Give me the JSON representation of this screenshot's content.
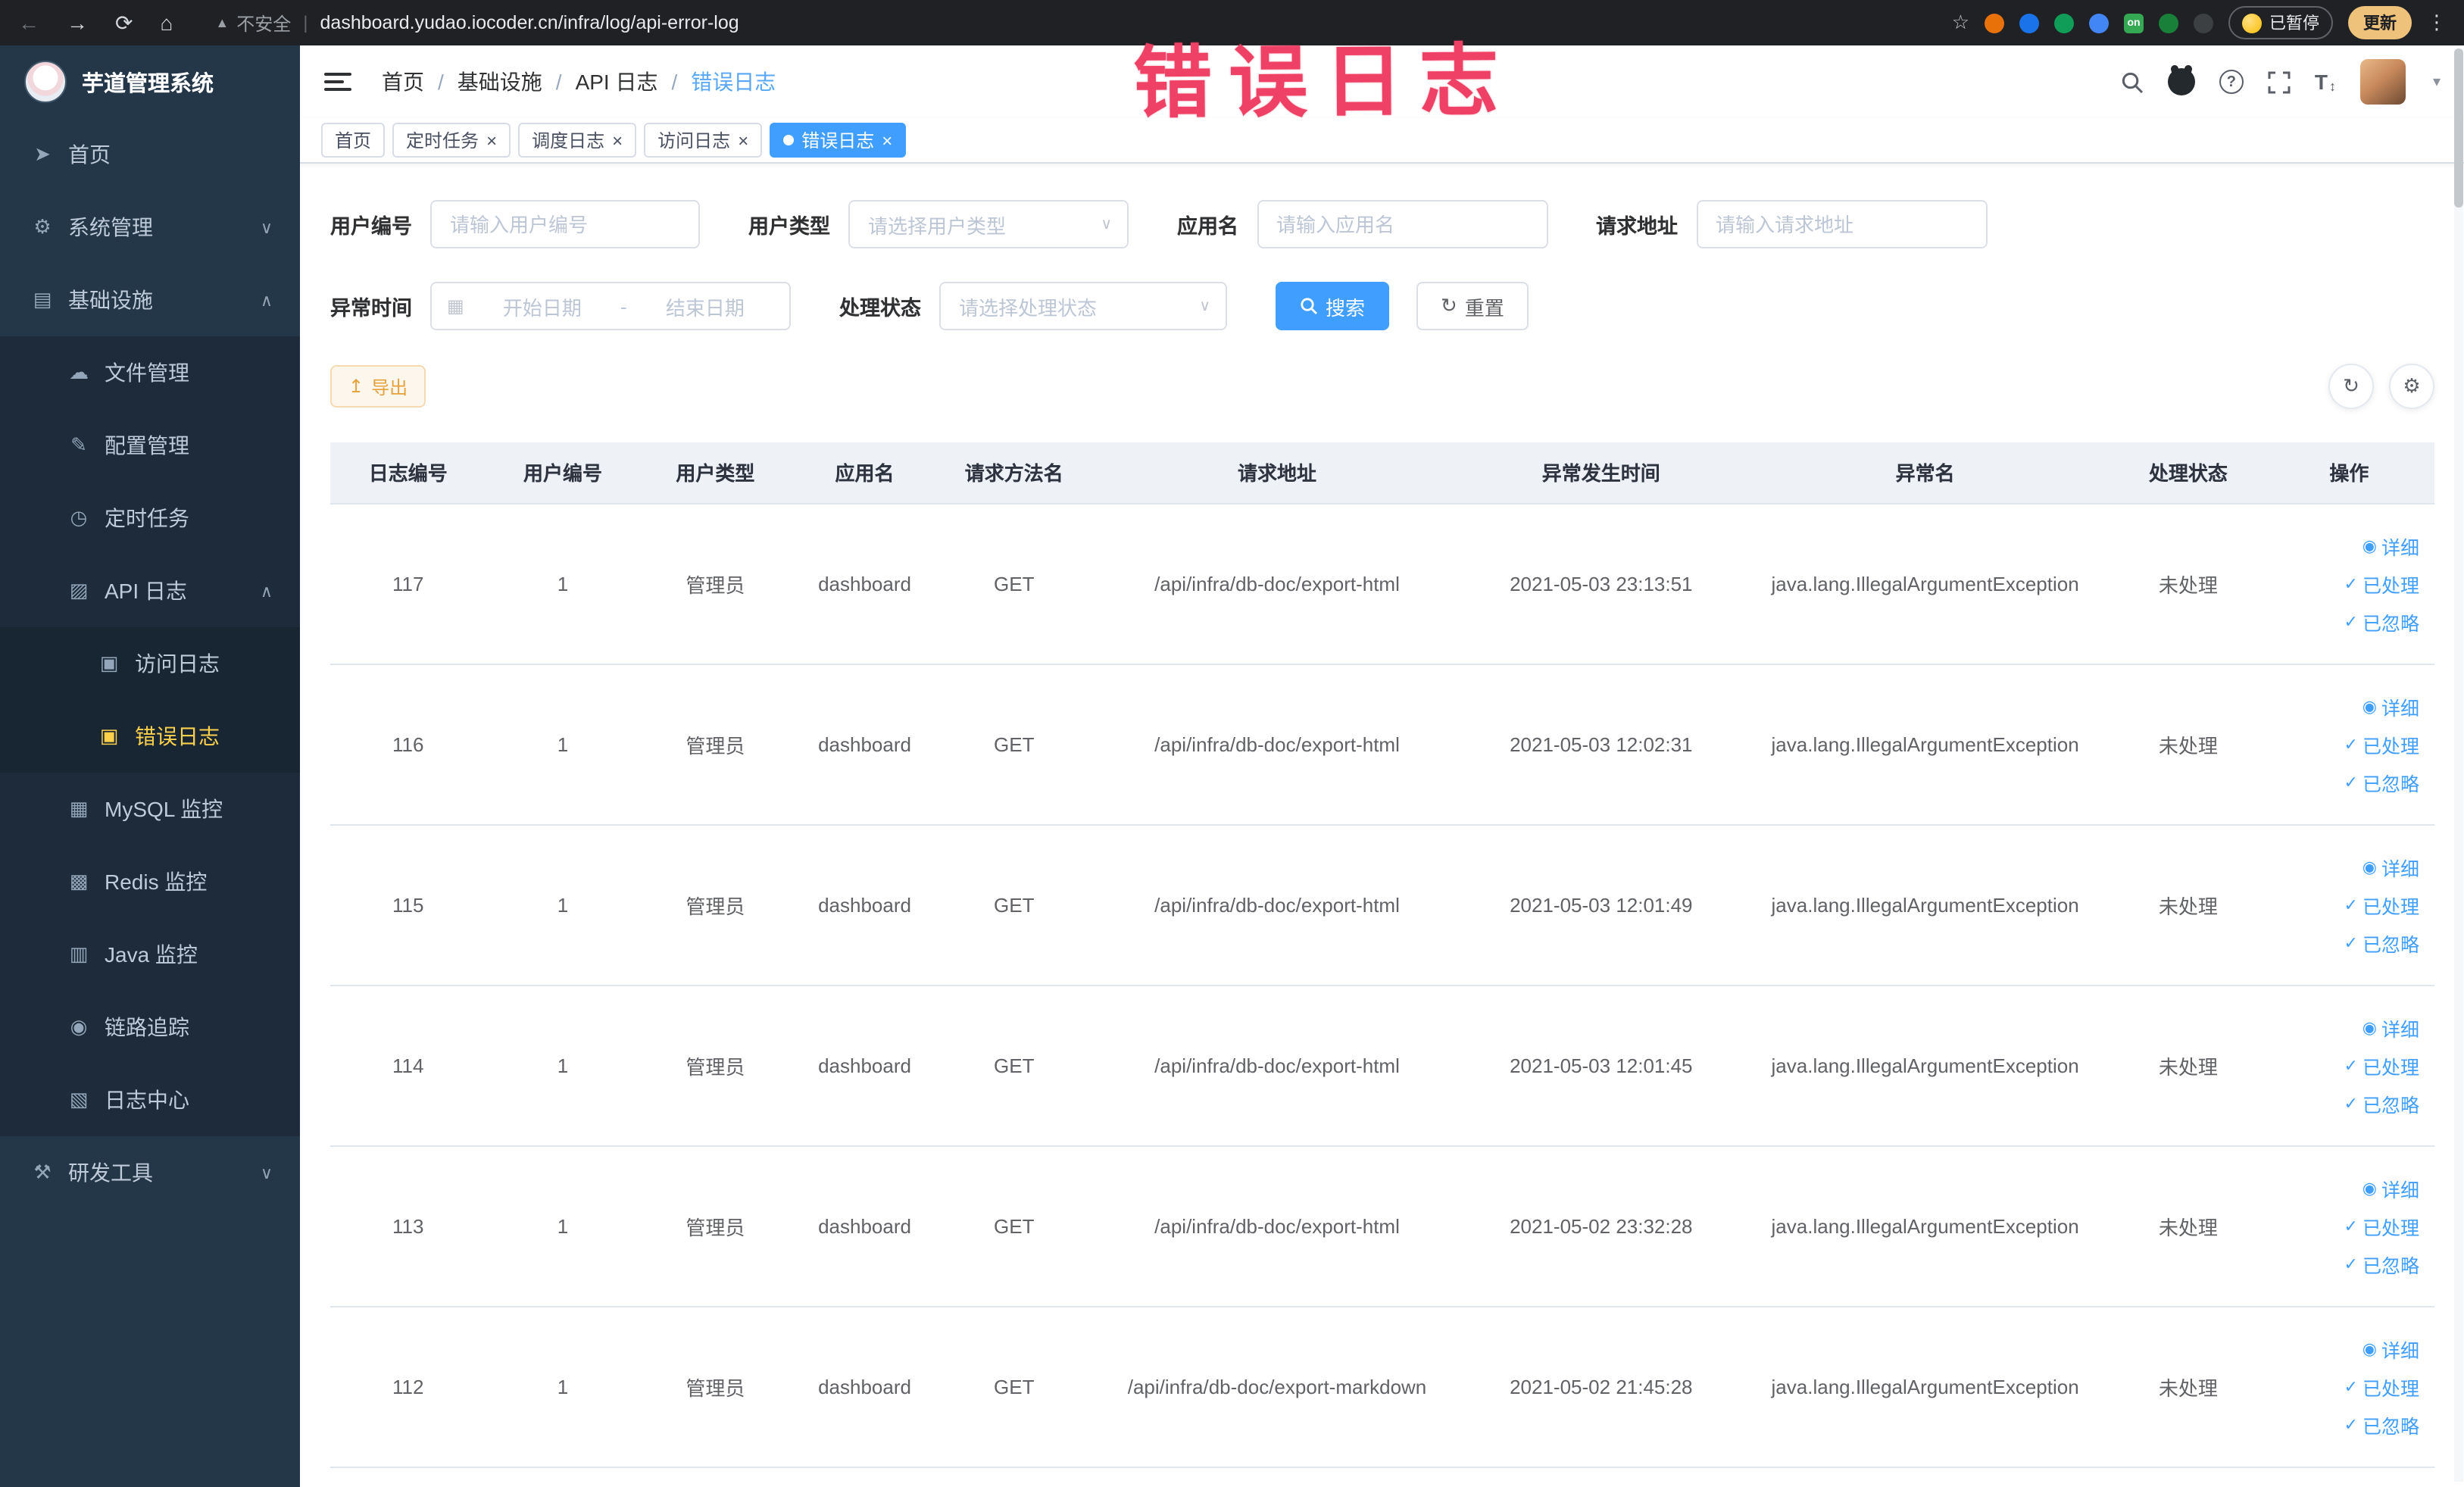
{
  "colors": {
    "accent_blue": "#409eff",
    "sidebar_active_yellow": "#ffd04b",
    "warning_orange": "#e6a23c",
    "annotation_pink": "#ef4165",
    "sidebar_bg": "#233749",
    "table_header_bg": "#eef1f6"
  },
  "ui": {
    "close_glyph": "×",
    "select_caret": "∨",
    "avatar_caret": "▾",
    "breadcrumb_separator": "/",
    "icons": {
      "back": "←",
      "forward": "→",
      "reload": "⟳",
      "home": "⌂",
      "warning_triangle": "▲",
      "star": "☆",
      "more": "⋮",
      "refresh": "↻",
      "export": "↥",
      "settings": "⚙",
      "eye": "◉",
      "check": "✓",
      "calendar": "▦",
      "help": "?",
      "font_size": "T",
      "font_size_arrow": "↕",
      "ext_on_label": "on"
    }
  },
  "browser": {
    "security_label": "不安全",
    "url": "dashboard.yudao.iocoder.cn/infra/log/api-error-log",
    "paused_label": "已暂停",
    "update_label": "更新"
  },
  "annotation": {
    "text": "错误日志"
  },
  "sidebar": {
    "logo_title": "芋道管理系统",
    "items": [
      {
        "label": "首页",
        "icon": "➤",
        "chevron": ""
      },
      {
        "label": "系统管理",
        "icon": "⚙",
        "chevron": "∨"
      },
      {
        "label": "基础设施",
        "icon": "▤",
        "chevron": "∧"
      },
      {
        "label": "文件管理",
        "icon": "☁",
        "chevron": ""
      },
      {
        "label": "配置管理",
        "icon": "✎",
        "chevron": ""
      },
      {
        "label": "定时任务",
        "icon": "◷",
        "chevron": ""
      },
      {
        "label": "API 日志",
        "icon": "▨",
        "chevron": "∧"
      },
      {
        "label": "访问日志",
        "icon": "▣",
        "chevron": ""
      },
      {
        "label": "错误日志",
        "icon": "▣",
        "chevron": ""
      },
      {
        "label": "MySQL 监控",
        "icon": "▦",
        "chevron": ""
      },
      {
        "label": "Redis 监控",
        "icon": "▩",
        "chevron": ""
      },
      {
        "label": "Java 监控",
        "icon": "▥",
        "chevron": ""
      },
      {
        "label": "链路追踪",
        "icon": "◉",
        "chevron": ""
      },
      {
        "label": "日志中心",
        "icon": "▧",
        "chevron": ""
      },
      {
        "label": "研发工具",
        "icon": "⚒",
        "chevron": "∨"
      }
    ]
  },
  "breadcrumb": {
    "items": [
      "首页",
      "基础设施",
      "API 日志",
      "错误日志"
    ]
  },
  "tabs": [
    {
      "label": "首页"
    },
    {
      "label": "定时任务"
    },
    {
      "label": "调度日志"
    },
    {
      "label": "访问日志"
    },
    {
      "label": "错误日志"
    }
  ],
  "filters": {
    "user_id": {
      "label": "用户编号",
      "placeholder": "请输入用户编号"
    },
    "user_type": {
      "label": "用户类型",
      "placeholder": "请选择用户类型"
    },
    "app_name": {
      "label": "应用名",
      "placeholder": "请输入应用名"
    },
    "request_url": {
      "label": "请求地址",
      "placeholder": "请输入请求地址"
    },
    "exception_time": {
      "label": "异常时间",
      "start_placeholder": "开始日期",
      "separator": "-",
      "end_placeholder": "结束日期"
    },
    "process_status": {
      "label": "处理状态",
      "placeholder": "请选择处理状态"
    },
    "search_label": "搜索",
    "reset_label": "重置"
  },
  "toolbar": {
    "export_label": "导出"
  },
  "table": {
    "columns": [
      "日志编号",
      "用户编号",
      "用户类型",
      "应用名",
      "请求方法名",
      "请求地址",
      "异常发生时间",
      "异常名",
      "处理状态",
      "操作"
    ],
    "actions": [
      "详细",
      "已处理",
      "已忽略"
    ],
    "rows": [
      {
        "id": "117",
        "user_id": "1",
        "user_type": "管理员",
        "app": "dashboard",
        "method": "GET",
        "url": "/api/infra/db-doc/export-html",
        "time": "2021-05-03 23:13:51",
        "exception": "java.lang.IllegalArgumentException",
        "status": "未处理"
      },
      {
        "id": "116",
        "user_id": "1",
        "user_type": "管理员",
        "app": "dashboard",
        "method": "GET",
        "url": "/api/infra/db-doc/export-html",
        "time": "2021-05-03 12:02:31",
        "exception": "java.lang.IllegalArgumentException",
        "status": "未处理"
      },
      {
        "id": "115",
        "user_id": "1",
        "user_type": "管理员",
        "app": "dashboard",
        "method": "GET",
        "url": "/api/infra/db-doc/export-html",
        "time": "2021-05-03 12:01:49",
        "exception": "java.lang.IllegalArgumentException",
        "status": "未处理"
      },
      {
        "id": "114",
        "user_id": "1",
        "user_type": "管理员",
        "app": "dashboard",
        "method": "GET",
        "url": "/api/infra/db-doc/export-html",
        "time": "2021-05-03 12:01:45",
        "exception": "java.lang.IllegalArgumentException",
        "status": "未处理"
      },
      {
        "id": "113",
        "user_id": "1",
        "user_type": "管理员",
        "app": "dashboard",
        "method": "GET",
        "url": "/api/infra/db-doc/export-html",
        "time": "2021-05-02 23:32:28",
        "exception": "java.lang.IllegalArgumentException",
        "status": "未处理"
      },
      {
        "id": "112",
        "user_id": "1",
        "user_type": "管理员",
        "app": "dashboard",
        "method": "GET",
        "url": "/api/infra/db-doc/export-markdown",
        "time": "2021-05-02 21:45:28",
        "exception": "java.lang.IllegalArgumentException",
        "status": "未处理"
      }
    ]
  }
}
